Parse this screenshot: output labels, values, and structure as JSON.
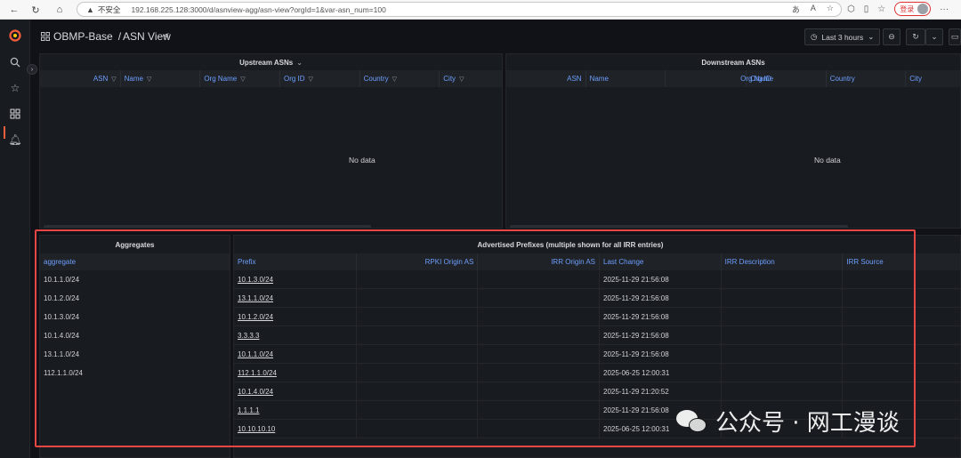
{
  "browser": {
    "insecure_label": "不安全",
    "url": "192.168.225.128:3000/d/asnview-agg/asn-view?orgId=1&var-asn_num=100",
    "login_label": "登录"
  },
  "header": {
    "folder": "OBMP-Base",
    "separator": "/",
    "title": "ASN View",
    "time_range": "Last 3 hours"
  },
  "upstream": {
    "title": "Upstream ASNs",
    "columns": [
      "ASN",
      "Name",
      "Org Name",
      "Org ID",
      "Country",
      "City"
    ],
    "empty_text": "No data"
  },
  "downstream": {
    "title": "Downstream ASNs",
    "columns": [
      "ASN",
      "Name",
      "Org Name",
      "Org ID",
      "Country",
      "City"
    ],
    "empty_text": "No data"
  },
  "aggregates": {
    "title": "Aggregates",
    "column": "aggregate",
    "rows": [
      "10.1.1.0/24",
      "10.1.2.0/24",
      "10.1.3.0/24",
      "10.1.4.0/24",
      "13.1.1.0/24",
      "112.1.1.0/24"
    ]
  },
  "advertised": {
    "title": "Advertised Prefixes (multiple shown for all IRR entries)",
    "columns": [
      "Prefix",
      "RPKI Origin AS",
      "IRR Origin AS",
      "Last Change",
      "IRR Description",
      "IRR Source"
    ],
    "rows": [
      {
        "prefix": "10.1.3.0/24",
        "last_change": "2025-11-29 21:56:08"
      },
      {
        "prefix": "13.1.1.0/24",
        "last_change": "2025-11-29 21:56:08"
      },
      {
        "prefix": "10.1.2.0/24",
        "last_change": "2025-11-29 21:56:08"
      },
      {
        "prefix": "3.3.3.3",
        "last_change": "2025-11-29 21:56:08"
      },
      {
        "prefix": "10.1.1.0/24",
        "last_change": "2025-11-29 21:56:08"
      },
      {
        "prefix": "112.1.1.0/24",
        "last_change": "2025-06-25 12:00:31"
      },
      {
        "prefix": "10.1.4.0/24",
        "last_change": "2025-11-29 21:20:52"
      },
      {
        "prefix": "1.1.1.1",
        "last_change": "2025-11-29 21:56:08"
      },
      {
        "prefix": "10.10.10.10",
        "last_change": "2025-06-25 12:00:31"
      }
    ]
  },
  "watermark": {
    "text": "公众号 · 网工漫谈"
  },
  "colors": {
    "highlight": "#e84545",
    "accent_link": "#6e9fff",
    "grafana_orange": "#f55f3e"
  }
}
